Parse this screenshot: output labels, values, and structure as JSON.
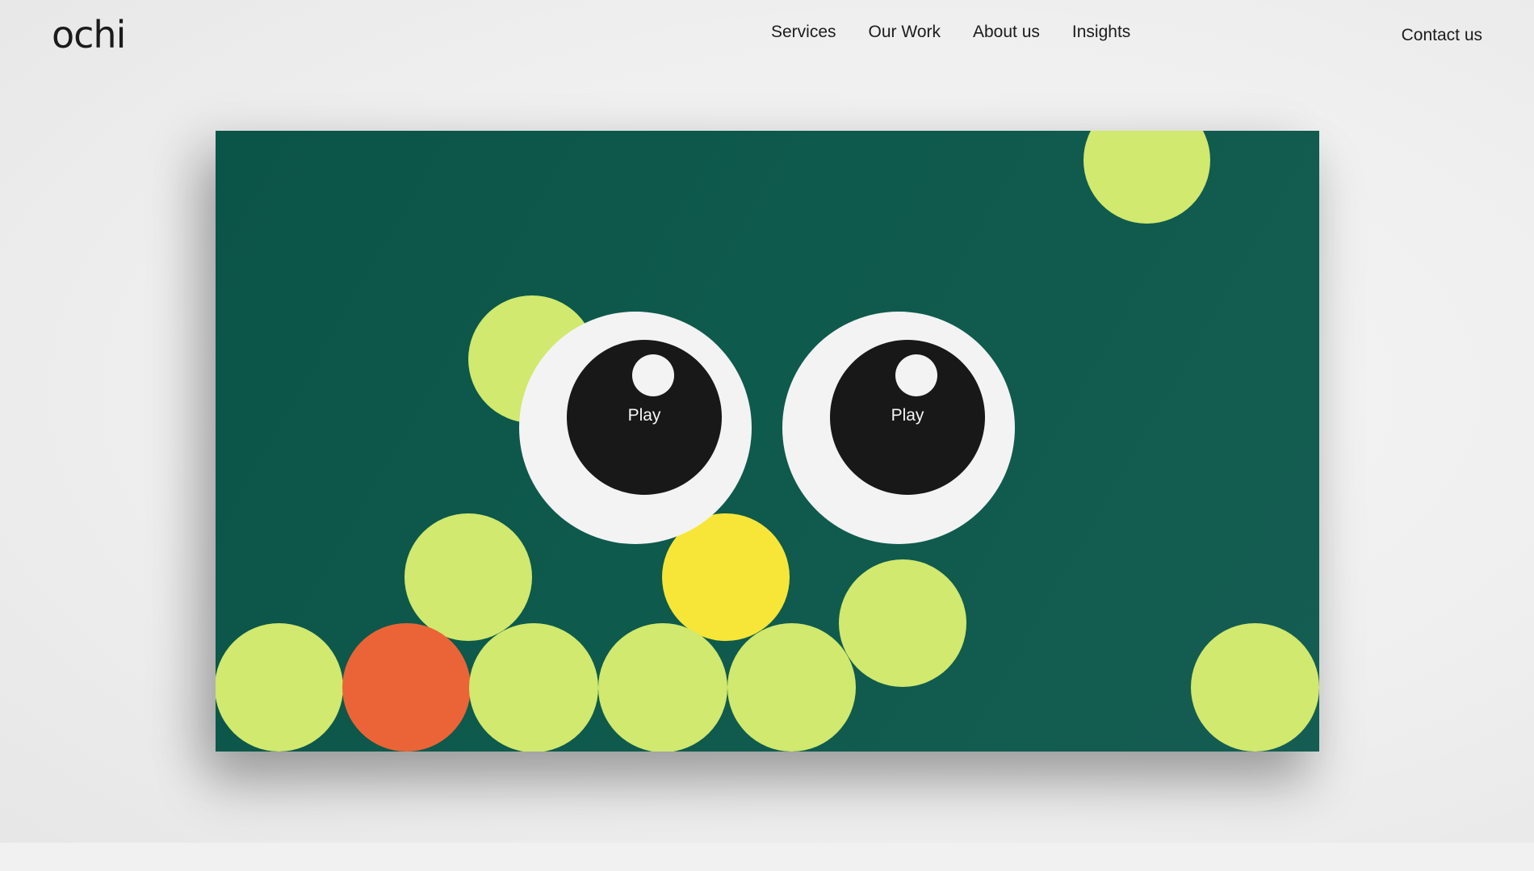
{
  "header": {
    "logo": "ochi",
    "nav": [
      "Services",
      "Our Work",
      "About us",
      "Insights"
    ],
    "contact": "Contact us"
  },
  "hero": {
    "eyes": [
      {
        "label": "Play"
      },
      {
        "label": "Play"
      }
    ]
  },
  "colors": {
    "background": "#f2f2f2",
    "card": "#0e5a4c",
    "ball_green": "#d0e96e",
    "ball_orange": "#eb6437",
    "ball_yellow": "#f7e637",
    "eye_white": "#f3f3f3",
    "pupil": "#181818",
    "text": "#1c1c1c"
  }
}
